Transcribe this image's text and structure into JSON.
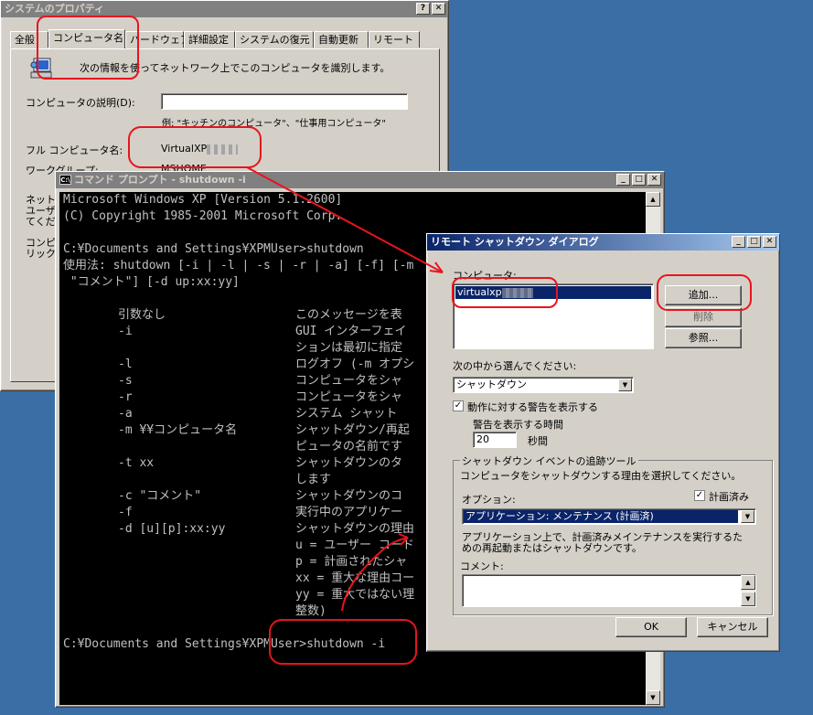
{
  "sysprops": {
    "title": "システムのプロパティ",
    "tabs": [
      "全般",
      "コンピュータ名",
      "ハードウェア",
      "詳細設定",
      "システムの復元",
      "自動更新",
      "リモート"
    ],
    "intro": "次の情報を使ってネットワーク上でこのコンピュータを識別します。",
    "desc_label": "コンピュータの説明(D):",
    "desc_value": "",
    "example": "例: \"キッチンのコンピュータ\"、\"仕事用コンピュータ\"",
    "fullname_label": "フル コンピュータ名:",
    "fullname_value": "VirtualXP",
    "workgroup_label": "ワークグループ:",
    "workgroup_value": "MSHOME",
    "side_labels": [
      "ネット",
      "ユーザ",
      "てくださ",
      "コンピ",
      "リックし"
    ]
  },
  "cmd": {
    "title": "コマンド プロンプト - shutdown -i",
    "header_lines": [
      "Microsoft Windows XP [Version 5.1.2600]",
      "(C) Copyright 1985-2001 Microsoft Corp.",
      "",
      "C:¥Documents and Settings¥XPMUser>shutdown",
      "使用法: shutdown [-i | -l | -s | -r | -a] [-f] [-m ",
      " \"コメント\"] [-d up:xx:yy]"
    ],
    "options": [
      {
        "flag": "引数なし",
        "desc": "このメッセージを表"
      },
      {
        "flag": "-i",
        "desc": "GUI インターフェイ"
      },
      {
        "flag": "",
        "desc": "ションは最初に指定"
      },
      {
        "flag": "-l",
        "desc": "ログオフ (-m オプシ"
      },
      {
        "flag": "-s",
        "desc": "コンピュータをシャ"
      },
      {
        "flag": "-r",
        "desc": "コンピュータをシャ"
      },
      {
        "flag": "-a",
        "desc": "システム シャット"
      },
      {
        "flag": "-m ¥¥コンピュータ名",
        "desc": "シャットダウン/再起"
      },
      {
        "flag": "",
        "desc": "ピュータの名前です"
      },
      {
        "flag": "-t xx",
        "desc": "シャットダウンのタ"
      },
      {
        "flag": "",
        "desc": "します"
      },
      {
        "flag": "-c \"コメント\"",
        "desc": "シャットダウンのコ"
      },
      {
        "flag": "-f",
        "desc": "実行中のアプリケー"
      },
      {
        "flag": "-d [u][p]:xx:yy",
        "desc": "シャットダウンの理由"
      },
      {
        "flag": "",
        "desc": "u = ユーザー コード"
      },
      {
        "flag": "",
        "desc": "p = 計画されたシャ"
      },
      {
        "flag": "",
        "desc": "xx = 重大な理由コー"
      },
      {
        "flag": "",
        "desc": "yy = 重大ではない理"
      },
      {
        "flag": "",
        "desc": "整数)"
      }
    ],
    "final_prompt": "C:¥Documents and Settings¥XPMUser>shutdown -i"
  },
  "shutdown_dialog": {
    "title": "リモート シャットダウン ダイアログ",
    "computers_label": "コンピュータ:",
    "computer_item": "virtualxp",
    "add_button": "追加...",
    "remove_button": "削除",
    "browse_button": "参照...",
    "choose_label": "次の中から選んでください:",
    "action_value": "シャットダウン",
    "warn_checkbox": "動作に対する警告を表示する",
    "warn_checked": true,
    "warn_time_label": "警告を表示する時間",
    "warn_time_value": "20",
    "seconds_label": "秒間",
    "event_group_label": "シャットダウン イベントの追跡ツール",
    "event_prompt": "コンピュータをシャットダウンする理由を選択してください。",
    "option_label": "オプション:",
    "planned_label": "計画済み",
    "planned_checked": true,
    "option_value": "アプリケーション: メンテナンス (計画済)",
    "option_desc": "アプリケーション上で、計画済みメインテナンスを実行するための再起動またはシャットダウンです。",
    "comment_label": "コメント:",
    "comment_value": "",
    "ok_button": "OK",
    "cancel_button": "キャンセル"
  },
  "colors": {
    "desktop": "#3a6ea5",
    "annotation_red": "#e8141e",
    "title_active": "#0a246a",
    "selection": "#0a246a"
  }
}
